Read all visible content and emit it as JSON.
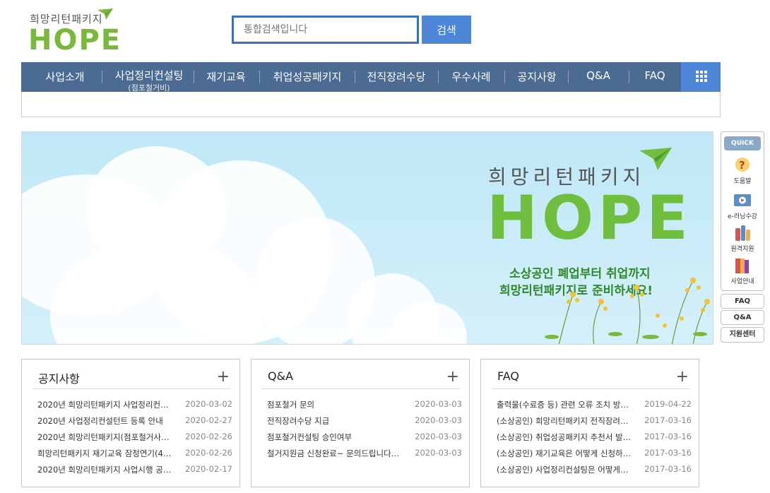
{
  "header": {
    "logo_tagline": "희망리턴패키지",
    "logo_word": "HOPE",
    "search_placeholder": "통합검색입니다",
    "search_button": "검색"
  },
  "nav": {
    "items": [
      {
        "label": "사업소개",
        "sub": ""
      },
      {
        "label": "사업정리컨설팅",
        "sub": "(점포철거비)"
      },
      {
        "label": "재기교육",
        "sub": ""
      },
      {
        "label": "취업성공패키지",
        "sub": ""
      },
      {
        "label": "전직장려수당",
        "sub": ""
      },
      {
        "label": "우수사례",
        "sub": ""
      },
      {
        "label": "공지사항",
        "sub": ""
      },
      {
        "label": "Q&A",
        "sub": ""
      },
      {
        "label": "FAQ",
        "sub": ""
      }
    ]
  },
  "banner": {
    "title": "희망리턴패키지",
    "word": "HOPE",
    "line1": "소상공인 폐업부터 취업까지",
    "line2": "희망리턴패키지로 준비하세요!"
  },
  "quick": {
    "head": "QUICK",
    "items": [
      {
        "label": "도움말",
        "icon": "help-icon"
      },
      {
        "label": "e-러닝수강",
        "icon": "e-learning-icon"
      },
      {
        "label": "원격지원",
        "icon": "remote-support-icon"
      },
      {
        "label": "사업안내",
        "icon": "business-guide-icon"
      }
    ],
    "links": [
      "FAQ",
      "Q&A",
      "지원센터"
    ]
  },
  "boards": [
    {
      "title": "공지사항",
      "rows": [
        {
          "title": "2020년 희망리턴패키지 사업정리컨…",
          "date": "2020-03-02"
        },
        {
          "title": "2020년 사업정리컨설턴트 등록 안내",
          "date": "2020-02-27"
        },
        {
          "title": "2020년 희망리턴패키지(점포철거사…",
          "date": "2020-02-26"
        },
        {
          "title": "희망리턴패키지 재기교육 잠정연기(4…",
          "date": "2020-02-26"
        },
        {
          "title": "2020년 희망리턴패키지 사업시행 공…",
          "date": "2020-02-17"
        }
      ]
    },
    {
      "title": "Q&A",
      "rows": [
        {
          "title": "점포철거 문의",
          "date": "2020-03-03"
        },
        {
          "title": "전직장려수당 지급",
          "date": "2020-03-03"
        },
        {
          "title": "점포철거컨설팅 승인여부",
          "date": "2020-03-03"
        },
        {
          "title": "철거지원금 신청완료~ 문의드립니다…",
          "date": "2020-03-03"
        }
      ]
    },
    {
      "title": "FAQ",
      "rows": [
        {
          "title": "출력물(수료증 등) 관련 오류 조치 방…",
          "date": "2019-04-22"
        },
        {
          "title": "(소상공인) 희망리턴패키지 전직장려…",
          "date": "2017-03-16"
        },
        {
          "title": "(소상공인) 취업성공패키지 추천서 발…",
          "date": "2017-03-16"
        },
        {
          "title": "(소상공인) 재기교육은 어떻게 신청하…",
          "date": "2017-03-16"
        },
        {
          "title": "(소상공인) 사업정리컨설팅은 어떻게…",
          "date": "2017-03-16"
        }
      ]
    }
  ],
  "colors": {
    "brand_green": "#7ab83a",
    "nav_bg": "#4c6b93",
    "accent_blue": "#4d86d6"
  }
}
